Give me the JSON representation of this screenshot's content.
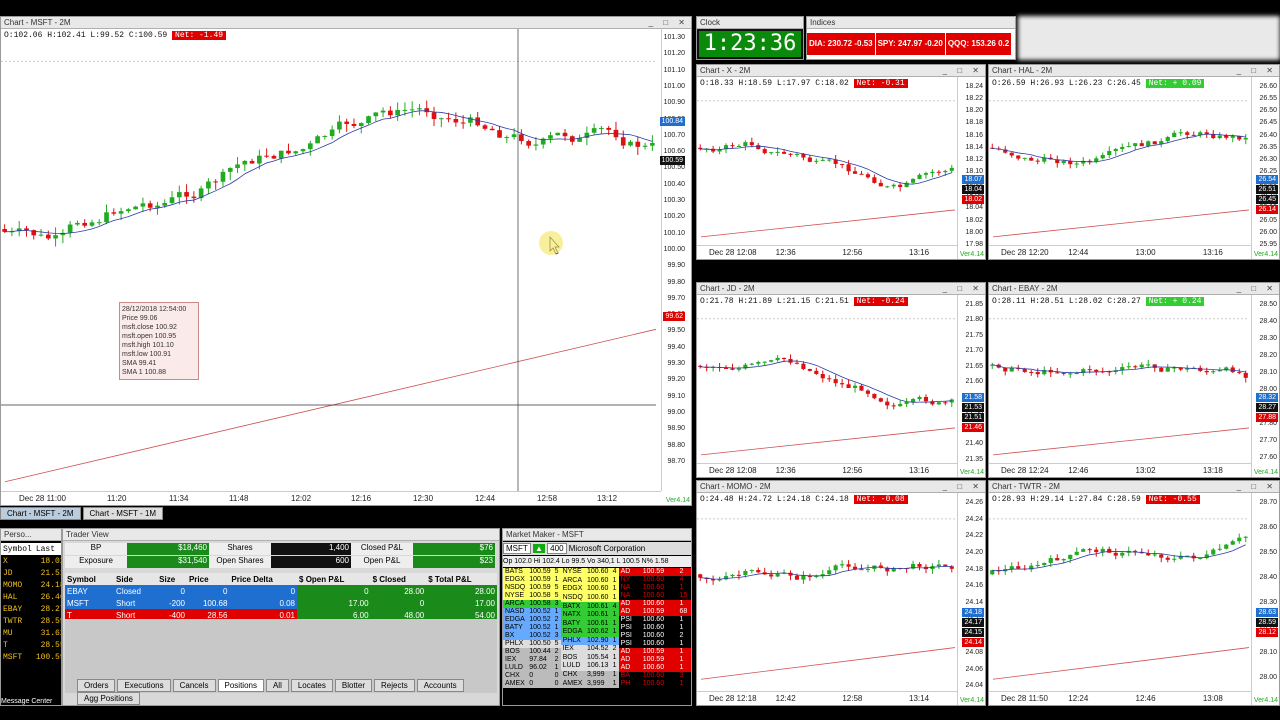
{
  "colors": {
    "up": "#22aa22",
    "down": "#dd1111",
    "sma": "#2a3aa8",
    "ma_red": "#d05050",
    "accent_green": "#33cc33",
    "red": "#e00000",
    "blue": "#1e6fd0"
  },
  "main_chart": {
    "title": "Chart - MSFT - 2M",
    "ohlc": "O:102.06 H:102.41 L:99.52 C:100.59",
    "net": "Net: -1.49",
    "y_labels": [
      "101.30",
      "101.20",
      "101.10",
      "101.00",
      "100.90",
      "100.80",
      "100.70",
      "100.60",
      "100.50",
      "100.40",
      "100.30",
      "100.20",
      "100.10",
      "100.00",
      "99.90",
      "99.80",
      "99.70",
      "99.60",
      "99.50",
      "99.40",
      "99.30",
      "99.20",
      "99.10",
      "99.00",
      "98.90",
      "98.80",
      "98.70"
    ],
    "x_labels": [
      "Dec 28 11:00",
      "11:20",
      "11:34",
      "11:48",
      "12:02",
      "12:16",
      "12:30",
      "12:44",
      "12:58",
      "13:12"
    ],
    "price_tags": [
      "100.84",
      "100.59",
      "99.62"
    ],
    "ver": "Ver4.14",
    "tooltip": [
      "28/12/2018 12:54:00",
      "Price  99.06",
      "msft.close  100.92",
      "msft.open  100.95",
      "msft.high  101.10",
      "msft.low  100.91",
      "SMA  99.41",
      "SMA 1  100.88"
    ],
    "tabs": [
      "Chart - MSFT - 2M",
      "Chart - MSFT - 1M"
    ]
  },
  "clock": {
    "title": "Clock",
    "time": "1:23:36"
  },
  "indices": {
    "title": "Indices",
    "items": [
      "DIA: 230.72  -0.53",
      "SPY: 247.97  -0.20",
      "QQQ: 153.26  0.2"
    ]
  },
  "small_charts": [
    {
      "title": "Chart - X - 2M",
      "ohlc": "O:18.33 H:18.59 L:17.97 C:18.02",
      "net": "Net: -0.31",
      "net_color": "#e00000",
      "y": [
        "18.24",
        "18.22",
        "18.20",
        "18.18",
        "18.16",
        "18.14",
        "18.12",
        "18.10",
        "18.08",
        "18.06",
        "18.04",
        "18.02",
        "18.00",
        "17.98"
      ],
      "x": [
        "Dec 28 12:08",
        "12:36",
        "12:56",
        "13:16"
      ],
      "tags": [
        "18.07",
        "18.04",
        "18.02"
      ]
    },
    {
      "title": "Chart - HAL - 2M",
      "ohlc": "O:26.59 H:26.93 L:26.23 C:26.45",
      "net": "Net: + 0.09",
      "net_color": "#33cc33",
      "y": [
        "26.60",
        "26.55",
        "26.50",
        "26.45",
        "26.40",
        "26.35",
        "26.30",
        "26.25",
        "26.20",
        "26.15",
        "26.10",
        "26.05",
        "26.00",
        "25.95"
      ],
      "x": [
        "Dec 28 12:20",
        "12:44",
        "13:00",
        "13:16"
      ],
      "tags": [
        "26.54",
        "26.51",
        "26.45",
        "26.14"
      ]
    },
    {
      "title": "Chart - JD - 2M",
      "ohlc": "O:21.78 H:21.89 L:21.15 C:21.51",
      "net": "Net: -0.24",
      "net_color": "#e00000",
      "y": [
        "21.85",
        "21.80",
        "21.75",
        "21.70",
        "21.65",
        "21.60",
        "21.55",
        "21.50",
        "21.45",
        "21.40",
        "21.35"
      ],
      "x": [
        "Dec 28 12:08",
        "12:36",
        "12:56",
        "13:16"
      ],
      "tags": [
        "21.58",
        "21.53",
        "21.51",
        "21.46"
      ]
    },
    {
      "title": "Chart - EBAY - 2M",
      "ohlc": "O:28.11 H:28.51 L:28.02 C:28.27",
      "net": "Net: + 0.24",
      "net_color": "#33cc33",
      "y": [
        "28.50",
        "28.40",
        "28.30",
        "28.20",
        "28.10",
        "28.00",
        "27.90",
        "27.80",
        "27.70",
        "27.60"
      ],
      "x": [
        "Dec 28 12:24",
        "12:46",
        "13:02",
        "13:18"
      ],
      "tags": [
        "28.32",
        "28.27",
        "27.88"
      ]
    },
    {
      "title": "Chart - MOMO - 2M",
      "ohlc": "O:24.48 H:24.72 L:24.18 C:24.18",
      "net": "Net: -0.08",
      "net_color": "#e00000",
      "y": [
        "24.26",
        "24.24",
        "24.22",
        "24.20",
        "24.18",
        "24.16",
        "24.14",
        "24.12",
        "24.10",
        "24.08",
        "24.06",
        "24.04"
      ],
      "x": [
        "Dec 28 12:18",
        "12:42",
        "12:58",
        "13:14"
      ],
      "tags": [
        "24.18",
        "24.17",
        "24.15",
        "24.14"
      ]
    },
    {
      "title": "Chart - TWTR - 2M",
      "ohlc": "O:28.93 H:29.14 L:27.84 C:28.59",
      "net": "Net: -0.55",
      "net_color": "#e00000",
      "y": [
        "28.70",
        "28.60",
        "28.50",
        "28.40",
        "28.30",
        "28.20",
        "28.10",
        "28.00"
      ],
      "x": [
        "Dec 28 11:50",
        "12:24",
        "12:46",
        "13:08"
      ],
      "tags": [
        "28.63",
        "28.59",
        "28.12"
      ]
    }
  ],
  "personal": {
    "title": "Perso...",
    "headers": [
      "Symbol",
      "Last"
    ],
    "rows": [
      [
        "X",
        "18.02"
      ],
      [
        "JD",
        "21.51"
      ],
      [
        "MOMO",
        "24.18"
      ],
      [
        "HAL",
        "26.46"
      ],
      [
        "EBAY",
        "28.27"
      ],
      [
        "TWTR",
        "28.59"
      ],
      [
        "MU",
        "31.62"
      ],
      [
        "T",
        "28.55"
      ],
      [
        "MSFT",
        "100.59"
      ]
    ],
    "footer": "Message Center"
  },
  "trader_view": {
    "title": "Trader View",
    "bp_label": "BP",
    "bp": "$18,460",
    "shares_label": "Shares",
    "shares": "1,400",
    "closed_label": "Closed P&L",
    "closed": "$76",
    "exposure_label": "Exposure",
    "exposure": "$31,540",
    "open_shares_label": "Open Shares",
    "open_shares": "600",
    "open_label": "Open P&L",
    "open": "$23",
    "headers": [
      "Symbol",
      "Side",
      "Size",
      "Price",
      "Price Delta",
      "$ Open P&L",
      "$ Closed",
      "$ Total P&L"
    ],
    "rows": [
      [
        "EBAY",
        "Closed",
        "0",
        "0",
        "0",
        "0",
        "28.00",
        "28.00"
      ],
      [
        "MSFT",
        "Short",
        "-200",
        "100.68",
        "0.08",
        "17.00",
        "0",
        "17.00"
      ],
      [
        "T",
        "Short",
        "-400",
        "28.56",
        "0.01",
        "6.00",
        "48.00",
        "54.00"
      ]
    ],
    "tabs": [
      "Orders",
      "Executions",
      "Cancels",
      "Positions",
      "All",
      "Locates",
      "Blotter",
      "Rejects",
      "Accounts",
      "Agg Positions"
    ]
  },
  "market_maker": {
    "title": "Market Maker - MSFT",
    "symbol": "MSFT",
    "lot": "400",
    "company": "Microsoft Corporation",
    "stats": "Op 102.0 Hi 102.4 Lo 99.5 Vo 340,1 L 100.5 N% 1.58",
    "bid_headers": [
      "MMID",
      "Bid",
      "Size"
    ],
    "bids": [
      [
        "BATS",
        "100.59",
        "5"
      ],
      [
        "EDGX",
        "100.59",
        "1"
      ],
      [
        "NSDQ",
        "100.59",
        "5"
      ],
      [
        "NYSE",
        "100.58",
        "5"
      ],
      [
        "ARCA",
        "100.58",
        "3"
      ],
      [
        "NASD",
        "100.52",
        "1"
      ],
      [
        "EDGA",
        "100.52",
        "2"
      ],
      [
        "BATY",
        "100.52",
        "1"
      ],
      [
        "BX",
        "100.52",
        "3"
      ],
      [
        "PHLX",
        "100.50",
        "5"
      ],
      [
        "BOS",
        "100.44",
        "2"
      ],
      [
        "IEX",
        "97.84",
        "2"
      ],
      [
        "LULD",
        "96.02",
        "1"
      ],
      [
        "CHX",
        "0",
        "0"
      ],
      [
        "AMEX",
        "0",
        "0"
      ]
    ],
    "ask_headers": [
      "MMID",
      "Ask",
      "Size"
    ],
    "asks": [
      [
        "NYSE",
        "100.60",
        "4"
      ],
      [
        "ARCA",
        "100.60",
        "1"
      ],
      [
        "EDGX",
        "100.60",
        "1"
      ],
      [
        "NSDQ",
        "100.60",
        "1"
      ],
      [
        "BATX",
        "100.61",
        "4"
      ],
      [
        "NATX",
        "100.61",
        "1"
      ],
      [
        "BATY",
        "100.61",
        "1"
      ],
      [
        "EDGA",
        "100.62",
        "1"
      ],
      [
        "PHLX",
        "102.90",
        "1"
      ],
      [
        "IEX",
        "104.52",
        "2"
      ],
      [
        "BOS",
        "105.54",
        "1"
      ],
      [
        "LULD",
        "106.13",
        "1"
      ],
      [
        "CHX",
        "3,999",
        "1"
      ],
      [
        "AMEX",
        "3,999",
        "1"
      ]
    ],
    "trade_headers": [
      "MM",
      "Trade",
      "Size"
    ],
    "trades": [
      [
        "AD",
        "100.59",
        "2"
      ],
      [
        "NY",
        "100.60",
        "4"
      ],
      [
        "NA",
        "100.60",
        "1"
      ],
      [
        "NA",
        "100.60",
        "15"
      ],
      [
        "AD",
        "100.60",
        "1"
      ],
      [
        "AD",
        "100.59",
        "68"
      ],
      [
        "PSI",
        "100.60",
        "1"
      ],
      [
        "PSI",
        "100.60",
        "1"
      ],
      [
        "PSI",
        "100.60",
        "2"
      ],
      [
        "PSI",
        "100.60",
        "1"
      ],
      [
        "AD",
        "100.59",
        "1"
      ],
      [
        "AD",
        "100.59",
        "1"
      ],
      [
        "AD",
        "100.60",
        "1"
      ],
      [
        "BA",
        "100.60",
        "3"
      ],
      [
        "PH",
        "100.60",
        "1"
      ]
    ]
  }
}
